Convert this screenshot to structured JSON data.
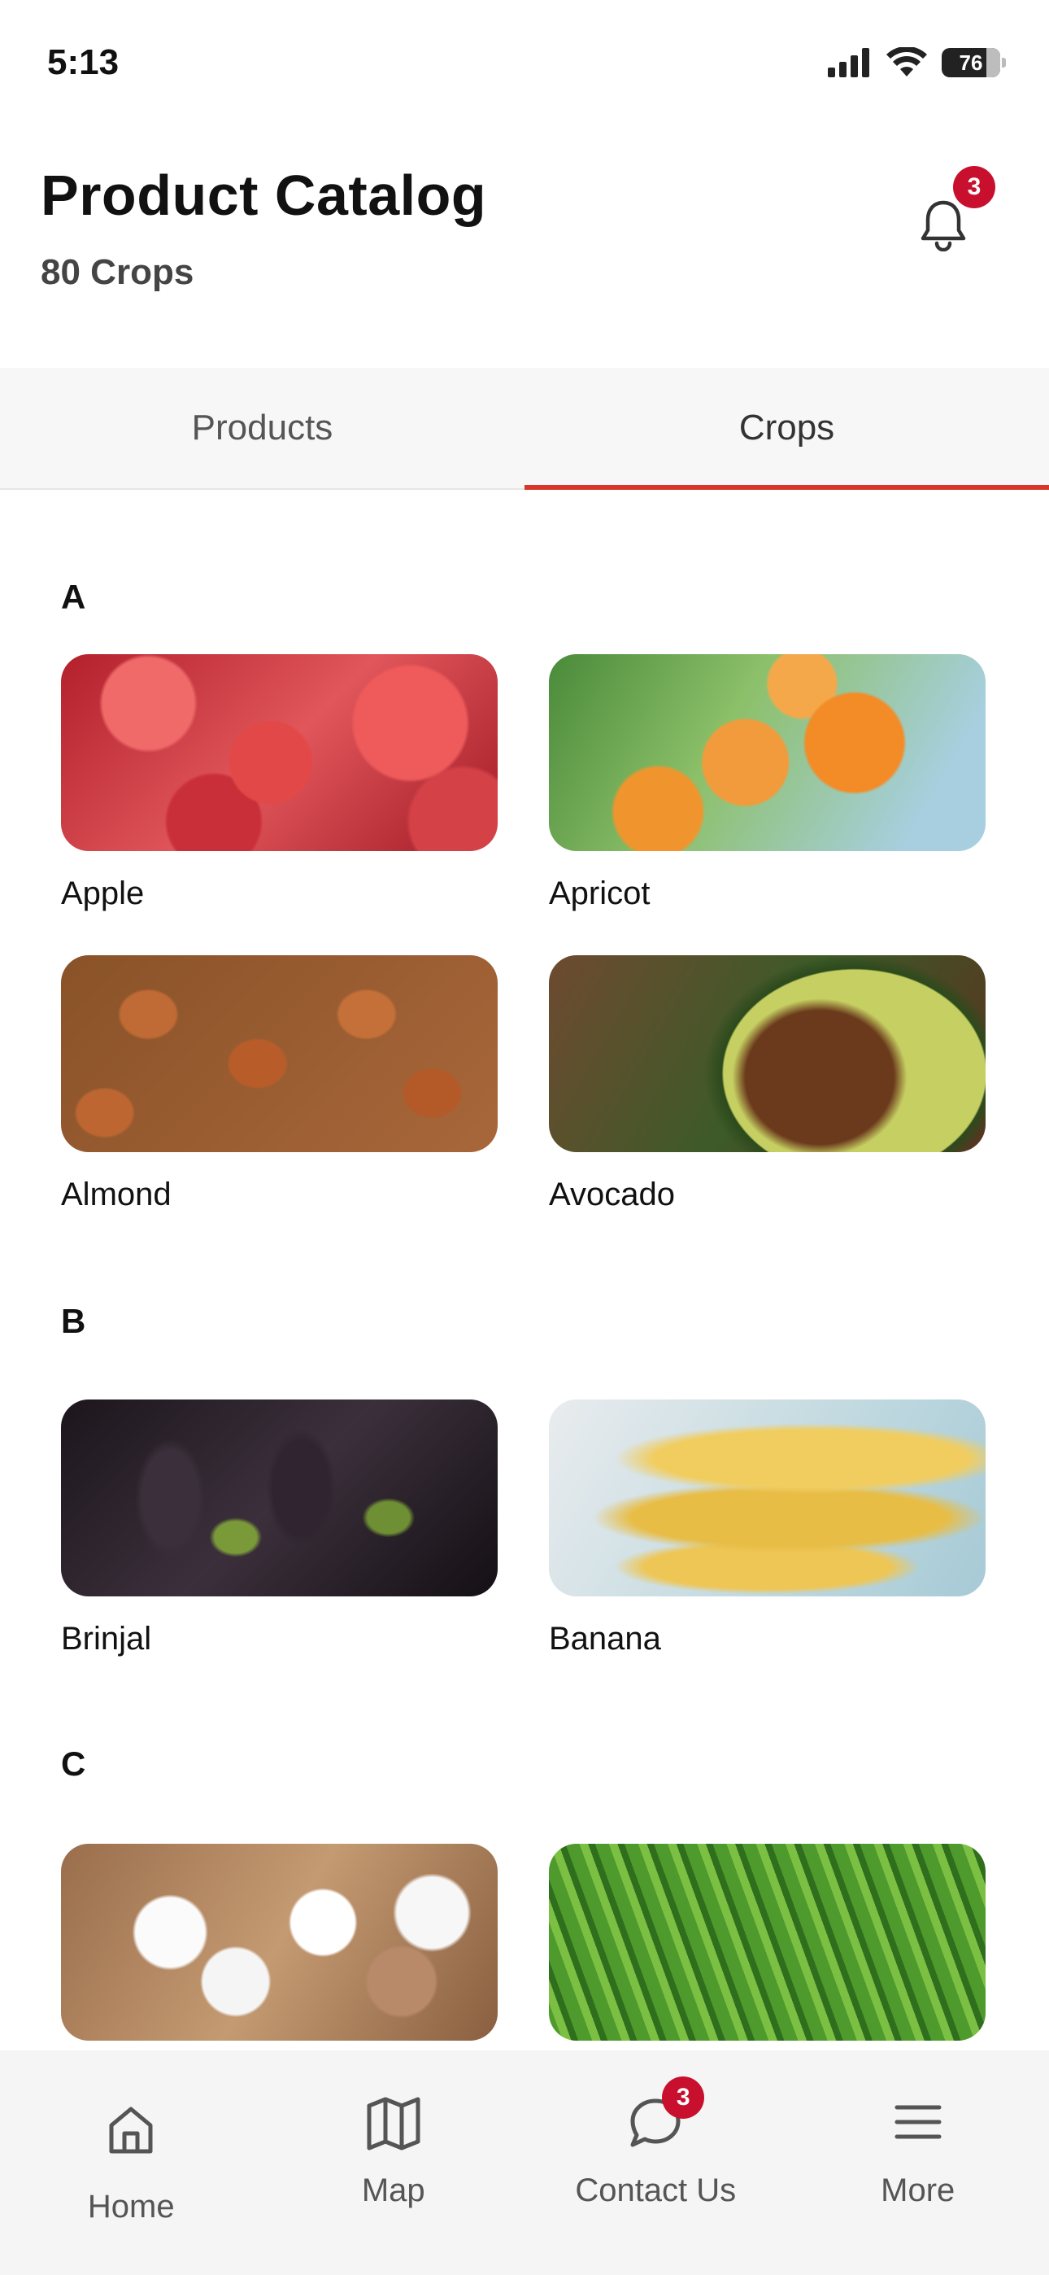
{
  "status_bar": {
    "time": "5:13",
    "battery": "76"
  },
  "header": {
    "title": "Product Catalog",
    "subtitle": "80 Crops",
    "notification_count": "3"
  },
  "tabs": [
    {
      "label": "Products",
      "active": false
    },
    {
      "label": "Crops",
      "active": true
    }
  ],
  "sections": [
    {
      "letter": "A",
      "items": [
        {
          "name": "Apple",
          "image": "apple-photo"
        },
        {
          "name": "Apricot",
          "image": "apricot-photo"
        },
        {
          "name": "Almond",
          "image": "almond-photo"
        },
        {
          "name": "Avocado",
          "image": "avocado-photo"
        }
      ]
    },
    {
      "letter": "B",
      "items": [
        {
          "name": "Brinjal",
          "image": "brinjal-photo"
        },
        {
          "name": "Banana",
          "image": "banana-photo"
        }
      ]
    },
    {
      "letter": "C",
      "items": [
        {
          "name": "",
          "image": "cotton-photo"
        },
        {
          "name": "",
          "image": "green-chilli-photo"
        }
      ]
    }
  ],
  "bottom_nav": [
    {
      "label": "Home",
      "icon": "home-icon",
      "active": true
    },
    {
      "label": "Map",
      "icon": "map-icon",
      "active": false
    },
    {
      "label": "Contact Us",
      "icon": "chat-icon",
      "active": false,
      "badge": "3"
    },
    {
      "label": "More",
      "icon": "menu-icon",
      "active": false
    }
  ],
  "colors": {
    "accent": "#d9362b",
    "badge": "#c8102e",
    "tab_bar": "#f7f7f7",
    "nav_bar": "#f5f5f5"
  }
}
